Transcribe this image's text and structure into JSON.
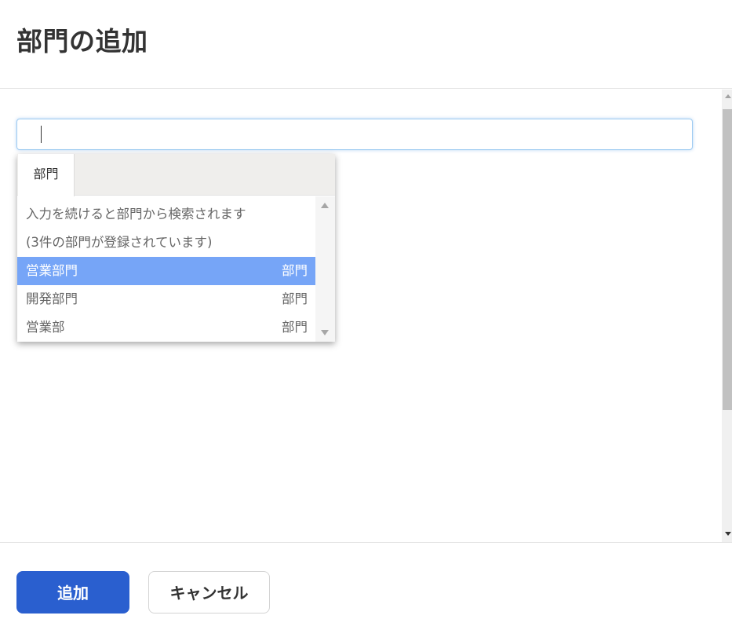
{
  "dialog": {
    "title": "部門の追加"
  },
  "search": {
    "value": "",
    "placeholder": ""
  },
  "dropdown": {
    "tab_label": "部門",
    "info_lines": [
      "入力を続けると部門から検索されます",
      "(3件の部門が登録されています)"
    ],
    "options": [
      {
        "name": "営業部門",
        "category": "部門",
        "selected": true
      },
      {
        "name": "開発部門",
        "category": "部門",
        "selected": false
      },
      {
        "name": "営業部",
        "category": "部門",
        "selected": false
      }
    ]
  },
  "footer": {
    "add_label": "追加",
    "cancel_label": "キャンセル"
  },
  "colors": {
    "primary": "#2a5fcf",
    "selected_row": "#76a5f7",
    "focus_border": "#9ecbf2"
  },
  "icons": {
    "dropdown_scroll_up": "triangle-up-icon",
    "dropdown_scroll_down": "triangle-down-icon"
  }
}
